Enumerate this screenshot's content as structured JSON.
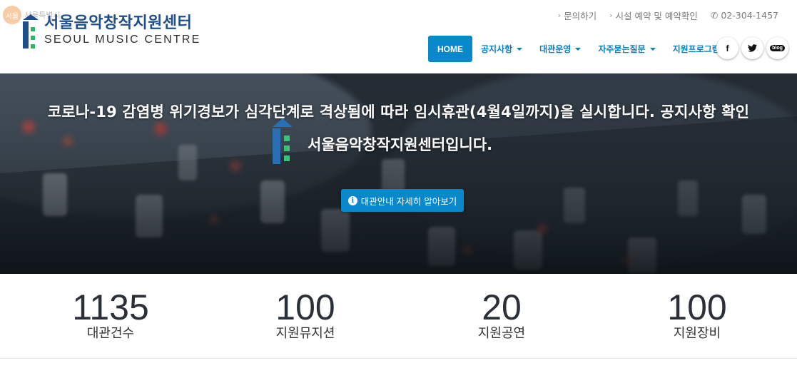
{
  "corner": {
    "text": "서울특별시"
  },
  "brand": {
    "name_ko": "서울음악창작지원센터",
    "name_en": "SEOUL MUSIC CENTRE"
  },
  "topbar": {
    "inquiry": "문의하기",
    "reservation": "시설 예약 및 예약확인",
    "phone": "02-304-1457"
  },
  "nav": {
    "home": "HOME",
    "items": [
      "공지사항",
      "대관운영",
      "자주묻는질문",
      "지원프로그램"
    ]
  },
  "social": {
    "facebook": "f",
    "twitter": "t",
    "blog": "blog"
  },
  "hero": {
    "line1": "코로나-19 감염병 위기경보가 심각단계로 격상됨에 따라 임시휴관(4월4일까지)을 실시합니다. 공지사항 확인",
    "line2": "서울음악창작지원센터입니다.",
    "button": "대관안내 자세히 알아보기"
  },
  "stats": [
    {
      "value": "1135",
      "label": "대관건수"
    },
    {
      "value": "100",
      "label": "지원뮤지션"
    },
    {
      "value": "20",
      "label": "지원공연"
    },
    {
      "value": "100",
      "label": "지원장비"
    }
  ],
  "colors": {
    "accent": "#0a88cc",
    "brand": "#1f4f8a"
  }
}
